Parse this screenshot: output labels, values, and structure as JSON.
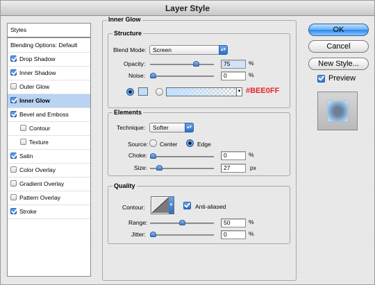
{
  "window": {
    "title": "Layer Style"
  },
  "sidebar": {
    "header": "Styles",
    "items": [
      {
        "label": "Blending Options: Default",
        "checkbox": false,
        "checked": false,
        "indent": false,
        "selected": false
      },
      {
        "label": "Drop Shadow",
        "checkbox": true,
        "checked": true,
        "indent": false,
        "selected": false
      },
      {
        "label": "Inner Shadow",
        "checkbox": true,
        "checked": true,
        "indent": false,
        "selected": false
      },
      {
        "label": "Outer Glow",
        "checkbox": true,
        "checked": false,
        "indent": false,
        "selected": false
      },
      {
        "label": "Inner Glow",
        "checkbox": true,
        "checked": true,
        "indent": false,
        "selected": true
      },
      {
        "label": "Bevel and Emboss",
        "checkbox": true,
        "checked": true,
        "indent": false,
        "selected": false
      },
      {
        "label": "Contour",
        "checkbox": true,
        "checked": false,
        "indent": true,
        "selected": false
      },
      {
        "label": "Texture",
        "checkbox": true,
        "checked": false,
        "indent": true,
        "selected": false
      },
      {
        "label": "Satin",
        "checkbox": true,
        "checked": true,
        "indent": false,
        "selected": false
      },
      {
        "label": "Color Overlay",
        "checkbox": true,
        "checked": false,
        "indent": false,
        "selected": false
      },
      {
        "label": "Gradient Overlay",
        "checkbox": true,
        "checked": false,
        "indent": false,
        "selected": false
      },
      {
        "label": "Pattern Overlay",
        "checkbox": true,
        "checked": false,
        "indent": false,
        "selected": false
      },
      {
        "label": "Stroke",
        "checkbox": true,
        "checked": true,
        "indent": false,
        "selected": false
      }
    ]
  },
  "panel": {
    "title": "Inner Glow",
    "structure": {
      "title": "Structure",
      "blend_mode_label": "Blend Mode:",
      "blend_mode_value": "Screen",
      "opacity_label": "Opacity:",
      "opacity_value": "75",
      "opacity_fraction": 0.75,
      "opacity_unit": "%",
      "noise_label": "Noise:",
      "noise_value": "0",
      "noise_fraction": 0,
      "noise_unit": "%",
      "glow_color": "#bee0ff",
      "color_annotation": "#BEE0FF"
    },
    "elements": {
      "title": "Elements",
      "technique_label": "Technique:",
      "technique_value": "Softer",
      "source_label": "Source:",
      "source_center": "Center",
      "source_edge": "Edge",
      "choke_label": "Choke:",
      "choke_value": "0",
      "choke_fraction": 0,
      "choke_unit": "%",
      "size_label": "Size:",
      "size_value": "27",
      "size_fraction": 0.11,
      "size_unit": "px"
    },
    "quality": {
      "title": "Quality",
      "contour_label": "Contour:",
      "anti_aliased_label": "Anti-aliased",
      "anti_aliased": true,
      "range_label": "Range:",
      "range_value": "50",
      "range_fraction": 0.5,
      "range_unit": "%",
      "jitter_label": "Jitter:",
      "jitter_value": "0",
      "jitter_fraction": 0,
      "jitter_unit": "%"
    }
  },
  "buttons": {
    "ok": "OK",
    "cancel": "Cancel",
    "new_style": "New Style...",
    "preview_label": "Preview",
    "preview_checked": true
  }
}
